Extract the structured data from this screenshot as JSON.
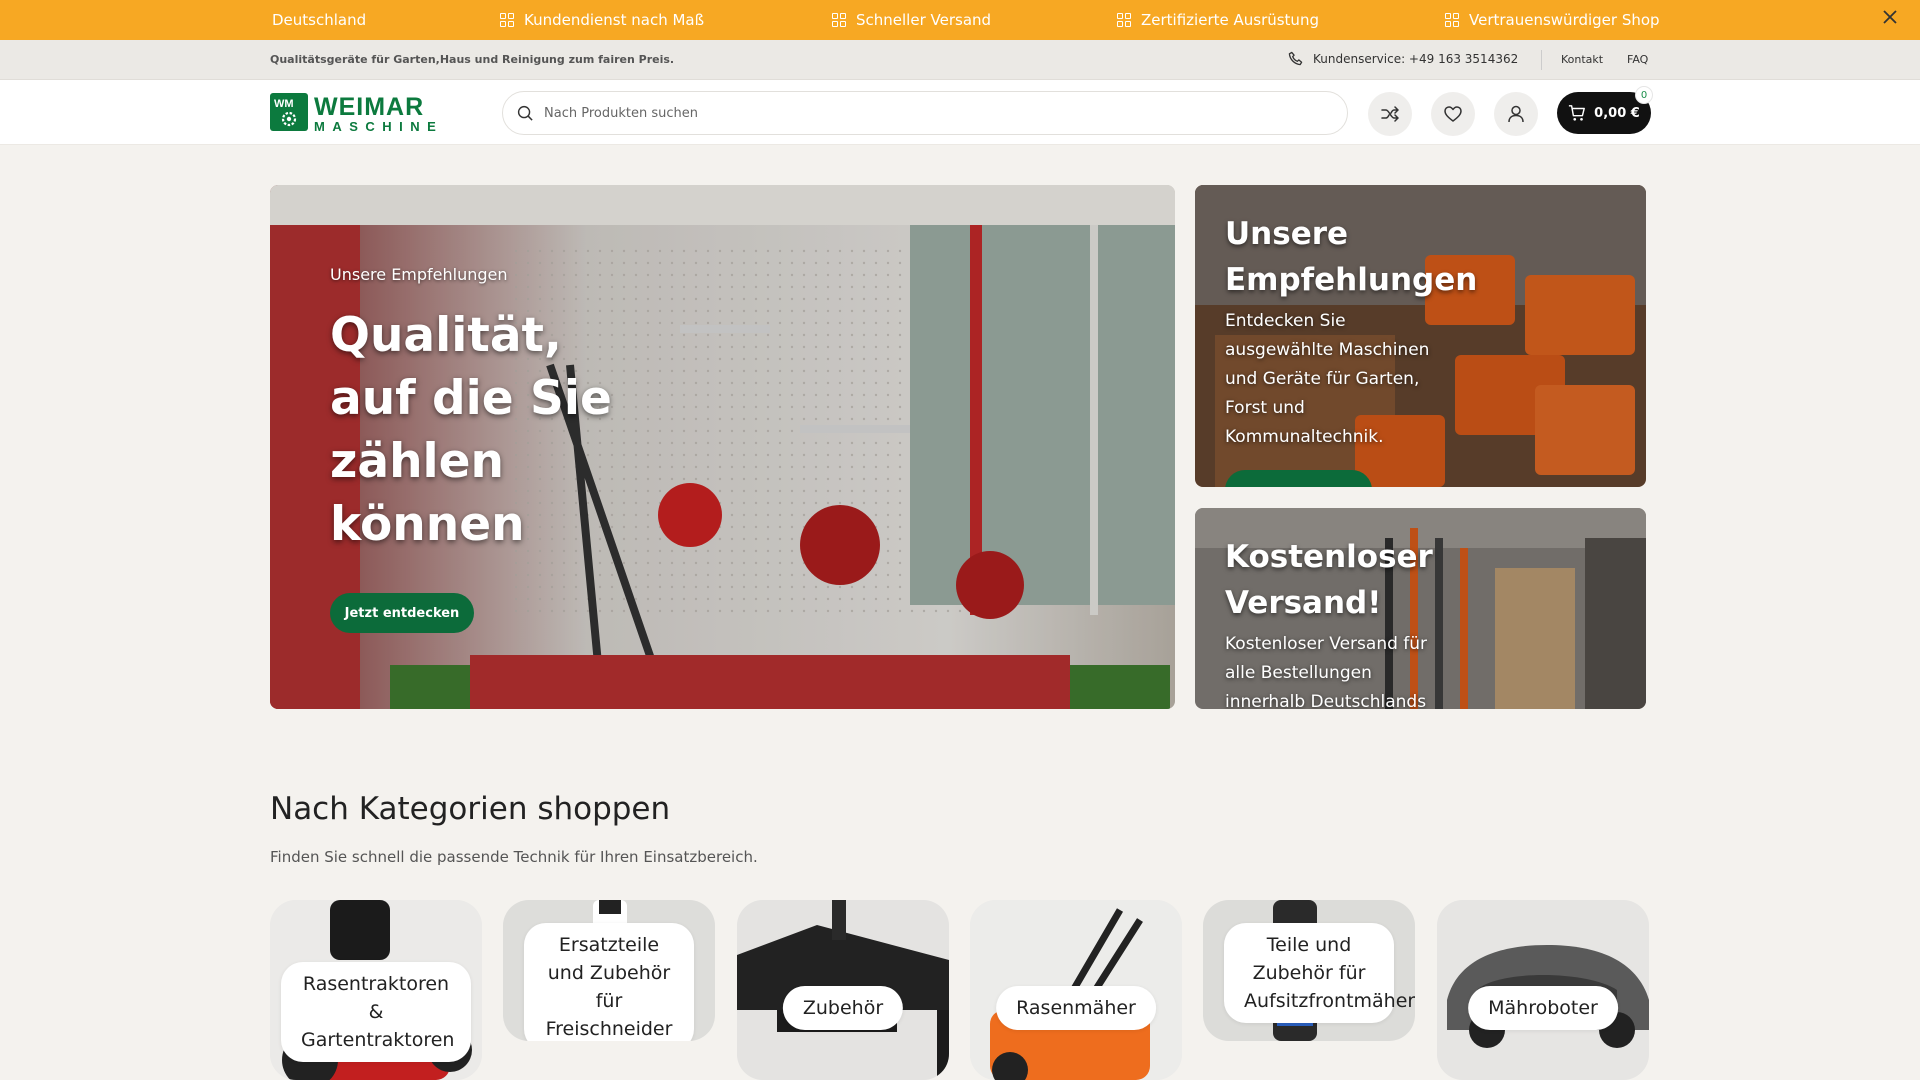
{
  "announcement": {
    "items": [
      "Deutschland",
      "Kundendienst nach Maß",
      "Schneller Versand",
      "Zertifizierte Ausrüstung",
      "Vertrauenswürdiger Shop"
    ],
    "icon": "grid-icon",
    "close_icon": "close-icon",
    "color": "#f7a823"
  },
  "topbar": {
    "tagline": "Qualitätsgeräte für Garten,Haus und Reinigung zum fairen Preis.",
    "phone_label": "Kundenservice: +49 163 3514362",
    "links": [
      "Kontakt",
      "FAQ"
    ]
  },
  "header": {
    "logo": {
      "line1": "WEIMAR",
      "line2": "MASCHINE",
      "badge": "WM"
    },
    "search_placeholder": "Nach Produkten suchen",
    "cart_total": "0,00 €",
    "cart_count": "0"
  },
  "hero": {
    "subtitle": "Unsere Empfehlungen",
    "title": "Qualität, auf die Sie zählen können",
    "cta": "Jetzt entdecken"
  },
  "promo_cards": [
    {
      "title": "Unsere Empfehlungen",
      "text": "Entdecken Sie ausgewählte Maschinen und Geräte für Garten, Forst und Kommunaltechnik."
    },
    {
      "title": "Kostenloser Versand!",
      "text": "Kostenloser Versand für alle Bestellungen innerhalb Deutschlands"
    }
  ],
  "categories": {
    "title": "Nach Kategorien shoppen",
    "subtitle": "Finden Sie schnell die passende Technik für Ihren Einsatzbereich.",
    "items": [
      "Rasentraktoren & Gartentraktoren",
      "Ersatzteile und Zubehör für Freischneider",
      "Zubehör",
      "Rasenmäher",
      "Teile und Zubehör für Aufsitzfrontmäher",
      "Mähroboter"
    ]
  },
  "colors": {
    "accent": "#f7a823",
    "brand_green": "#0c6b3a",
    "cart_bg": "#111111"
  }
}
